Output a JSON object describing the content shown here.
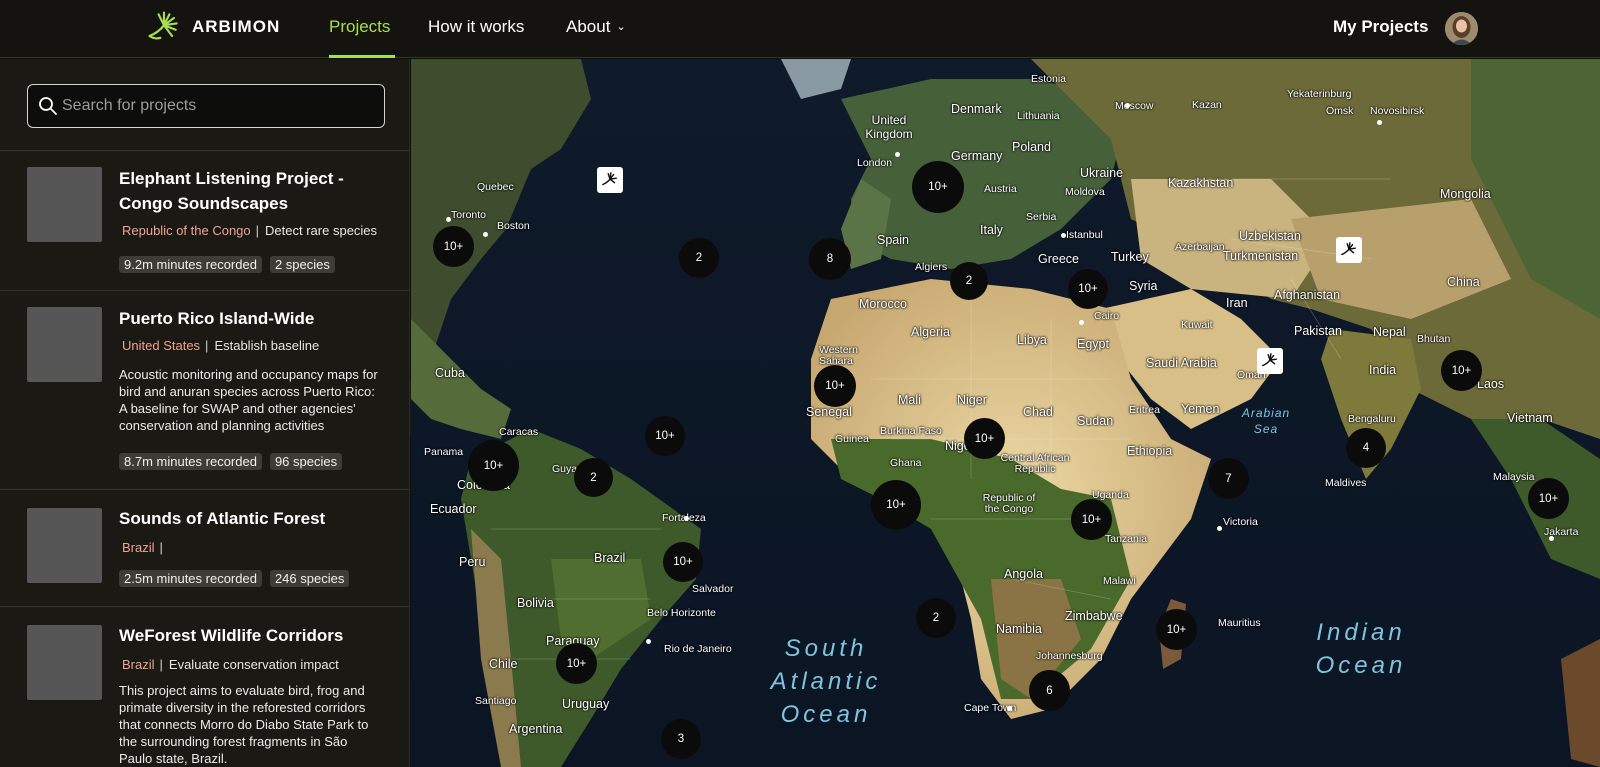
{
  "nav": {
    "logo_text": "ARBIMON",
    "links": {
      "projects": "Projects",
      "how": "How it works",
      "about": "About"
    },
    "my_projects": "My Projects",
    "accent": "#a9de4f"
  },
  "search": {
    "placeholder": "Search for projects",
    "value": ""
  },
  "projects": [
    {
      "title": "Elephant Listening Project - Congo Soundscapes",
      "country": "Republic of the Congo",
      "objective": "Detect rare species",
      "minutes": "9.2m minutes recorded",
      "species": "2 species"
    },
    {
      "title": "Puerto Rico Island-Wide",
      "country": "United States",
      "objective": "Establish baseline",
      "description": "Acoustic monitoring and occupancy maps for bird and anuran species across Puerto Rico: A baseline for SWAP and other agencies' conservation and planning activities",
      "minutes": "8.7m minutes recorded",
      "species": "96 species"
    },
    {
      "title": "Sounds of Atlantic Forest",
      "country": "Brazil",
      "objective": "",
      "minutes": "2.5m minutes recorded",
      "species": "246 species"
    },
    {
      "title": "WeForest Wildlife Corridors",
      "country": "Brazil",
      "objective": "Evaluate conservation impact",
      "description": "This project aims to evaluate bird, frog and primate diversity in the reforested corridors that connects Morro do Diabo State Park to the surrounding forest fragments in São Paulo state, Brazil."
    }
  ],
  "map": {
    "oceans": {
      "south_atlantic": "South Atlantic Ocean",
      "indian": "Indian Ocean",
      "arabian_sea": "Arabian Sea"
    },
    "labels": [
      "Estonia",
      "Denmark",
      "Lithuania",
      "Moscow",
      "Kazan",
      "Yekaterinburg",
      "Omsk",
      "Novosibirsk",
      "United Kingdom",
      "London",
      "Germany",
      "Poland",
      "Ukraine",
      "Austria",
      "Moldova",
      "Kazakhstan",
      "Mongolia",
      "Quebec",
      "Toronto",
      "Boston",
      "Serbia",
      "Italy",
      "Istanbul",
      "Spain",
      "Greece",
      "Turkey",
      "Azerbaijan",
      "Uzbekistan",
      "Turkmenistan",
      "China",
      "Algiers",
      "Syria",
      "Iran",
      "Afghanistan",
      "Morocco",
      "Cairo",
      "Kuwait",
      "Pakistan",
      "Nepal",
      "Bhutan",
      "Algeria",
      "Libya",
      "Egypt",
      "Saudi Arabia",
      "Oman",
      "India",
      "Laos",
      "Western Sahara",
      "Cuba",
      "Mali",
      "Niger",
      "Chad",
      "Sudan",
      "Eritrea",
      "Yemen",
      "Senegal",
      "Guinea",
      "Burkina Faso",
      "Bengaluru",
      "Vietnam",
      "Caracas",
      "Panama",
      "Nigeria",
      "Ghana",
      "Central African Republic",
      "Ethiopia",
      "Guyana",
      "Colombia",
      "Maldives",
      "Malaysia",
      "Ecuador",
      "Republic of the Congo",
      "Uganda",
      "Victoria",
      "Fortaleza",
      "Tanzania",
      "Jakarta",
      "Peru",
      "Brazil",
      "Salvador",
      "Angola",
      "Malawi",
      "Bolivia",
      "Belo Horizonte",
      "Paraguay",
      "Zimbabwe",
      "Namibia",
      "Mauritius",
      "Rio de Janeiro",
      "Chile",
      "Johannesburg",
      "Santiago",
      "Uruguay",
      "Cape Town",
      "Argentina"
    ],
    "clusters": [
      "10+",
      "10+",
      "2",
      "8",
      "2",
      "10+",
      "10+",
      "10+",
      "10+",
      "10+",
      "2",
      "10+",
      "10+",
      "4",
      "7",
      "10+",
      "10+",
      "10+",
      "2",
      "10+",
      "6",
      "10+",
      "3"
    ]
  }
}
